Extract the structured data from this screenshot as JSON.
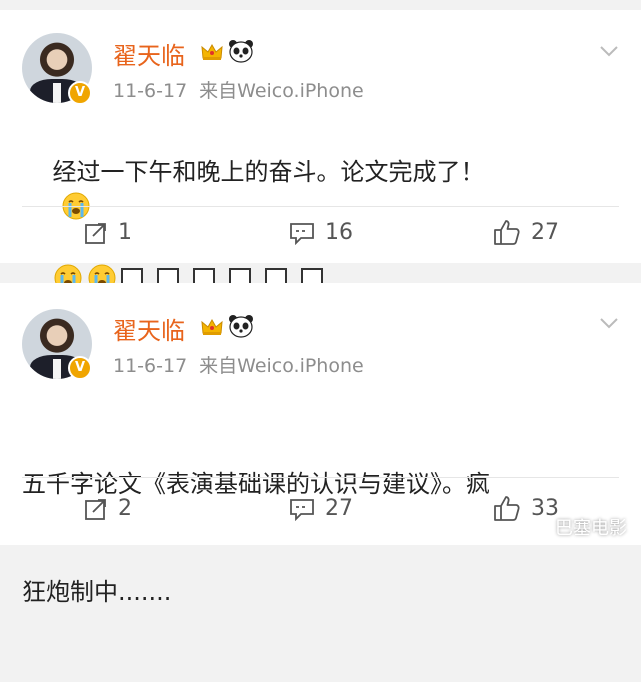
{
  "posts": [
    {
      "user": "翟天临",
      "time": "11-6-17",
      "source": "来自Weico.iPhone",
      "text_line1": "经过一下午和晚上的奋斗。论文完成了！",
      "actions": {
        "repost": "1",
        "comment": "16",
        "like": "27"
      },
      "icons": [
        "crown-icon",
        "panda-icon",
        "crying-emoji-icon",
        "verified-badge-icon",
        "chevron-down-icon"
      ]
    },
    {
      "user": "翟天临",
      "time": "11-6-17",
      "source": "来自Weico.iPhone",
      "text_line1": "五千字论文《表演基础课的认识与建议》。疯",
      "text_line2": "狂炮制中.......",
      "actions": {
        "repost": "2",
        "comment": "27",
        "like": "33"
      }
    }
  ],
  "watermark": "巴塞电影",
  "colors": {
    "name": "#e8641c",
    "meta": "#8d8d8d",
    "background": "#f2f2f2",
    "verified": "#f0a500"
  }
}
